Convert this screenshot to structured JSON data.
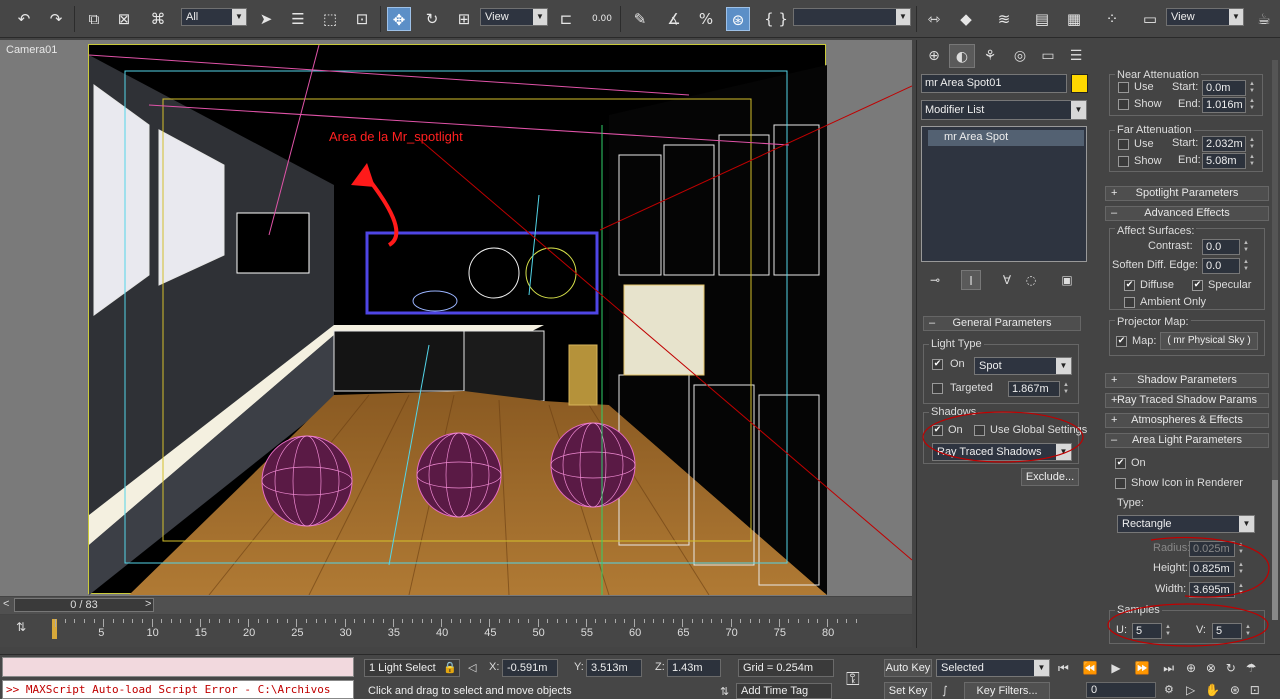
{
  "toolbar": {
    "selection_filter": "All",
    "ref_coord": "View",
    "spinner_snap": "0.00",
    "named_selection": "",
    "render_view": "View"
  },
  "viewport": {
    "label": "Camera01",
    "annotation": "Area de la Mr_spotlight"
  },
  "command_panel": {
    "object_name": "mr Area Spot01",
    "object_color": "#ffd800",
    "modifier_list": "Modifier List",
    "stack_item": "mr Area Spot",
    "near_atten": {
      "title": "Near Attenuation",
      "use_label": "Use",
      "show_label": "Show",
      "start_label": "Start:",
      "start_value": "0.0m",
      "end_label": "End:",
      "end_value": "1.016m"
    },
    "far_atten": {
      "title": "Far Attenuation",
      "use_label": "Use",
      "show_label": "Show",
      "start_label": "Start:",
      "start_value": "2.032m",
      "end_label": "End:",
      "end_value": "5.08m"
    },
    "spotlight_params": "Spotlight Parameters",
    "advanced_effects": "Advanced Effects",
    "affect_surfaces": "Affect Surfaces:",
    "contrast_label": "Contrast:",
    "contrast_value": "0.0",
    "soften_label": "Soften Diff. Edge:",
    "soften_value": "0.0",
    "diffuse_label": "Diffuse",
    "specular_label": "Specular",
    "ambient_label": "Ambient Only",
    "projector_map": "Projector Map:",
    "map_label": "Map:",
    "map_value": "( mr Physical Sky )",
    "shadow_params": "Shadow Parameters",
    "raytraced_params": "Ray Traced Shadow Params",
    "atmos_effects": "Atmospheres & Effects",
    "area_params": "Area Light Parameters",
    "area_on_label": "On",
    "show_icon_label": "Show Icon in Renderer",
    "type_label": "Type:",
    "type_value": "Rectangle",
    "radius_label": "Radius:",
    "radius_value": "0.025m",
    "height_label": "Height:",
    "height_value": "0.825m",
    "width_label": "Width:",
    "width_value": "3.695m",
    "samples_title": "Samples",
    "u_label": "U:",
    "u_value": "5",
    "v_label": "V:",
    "v_value": "5",
    "general_params": "General Parameters",
    "light_type_title": "Light Type",
    "light_on_label": "On",
    "light_type_value": "Spot",
    "targeted_label": "Targeted",
    "targeted_value": "1.867m",
    "shadows_title": "Shadows",
    "shadows_on_label": "On",
    "use_global_label": "Use Global Settings",
    "shadow_type": "Ray Traced Shadows",
    "exclude_label": "Exclude..."
  },
  "timeline": {
    "frame_display": "0 / 83",
    "ticks": [
      "5",
      "10",
      "15",
      "20",
      "25",
      "30",
      "35",
      "40",
      "45",
      "50",
      "55",
      "60",
      "65",
      "70",
      "75",
      "80"
    ]
  },
  "status": {
    "script_error": ">> MAXScript Auto-load Script Error - C:\\Archivos",
    "selection_info": "1 Light Select",
    "prompt": "Click and drag to select and move objects",
    "x_label": "X:",
    "x_value": "-0.591m",
    "y_label": "Y:",
    "y_value": "3.513m",
    "z_label": "Z:",
    "z_value": "1.43m",
    "grid": "Grid = 0.254m",
    "add_time_tag": "Add Time Tag",
    "auto_key": "Auto Key",
    "set_key": "Set Key",
    "key_mode": "Selected",
    "key_filters": "Key Filters...",
    "current_frame": "0"
  }
}
